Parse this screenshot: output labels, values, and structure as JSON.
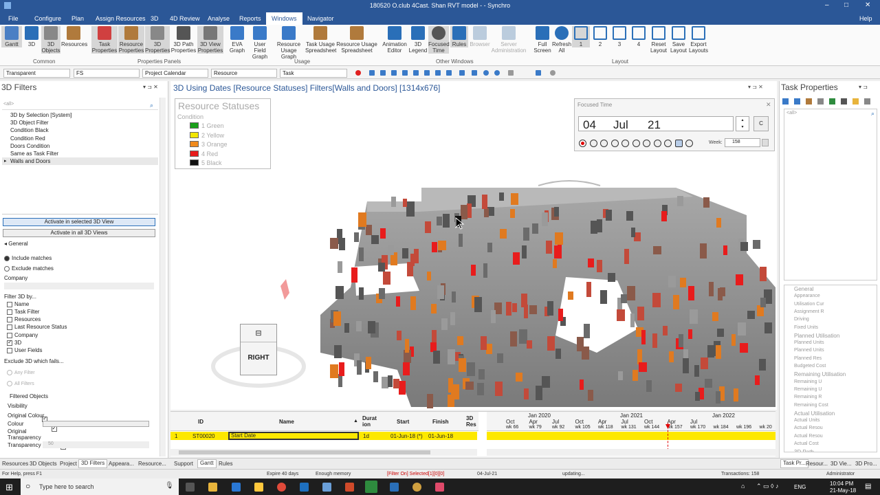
{
  "app": {
    "title": "180520 O.club 4Cast. Shan RVT model - - Synchro"
  },
  "menu": {
    "file": "File",
    "configure": "Configure",
    "plan": "Plan",
    "assign": "Assign Resources",
    "three_d": "3D",
    "review": "4D Review",
    "analyse": "Analyse",
    "reports": "Reports",
    "windows": "Windows",
    "navigator": "Navigator",
    "help": "Help"
  },
  "ribbon": {
    "buttons": [
      "Gantt",
      "3D",
      "3D Objects",
      "Resources",
      "Task Properties",
      "Resource Properties",
      "3D Properties",
      "3D Path Properties",
      "3D View Properties",
      "EVA Graph",
      "User Field Graph",
      "Resource Usage Graph",
      "Task Usage Spreadsheet",
      "Resource Usage Spreadsheet",
      "Animation Editor",
      "3D Legend",
      "Focused Time",
      "Rules",
      "Browser",
      "Server Administration",
      "Full Screen",
      "Refresh All",
      "1",
      "2",
      "3",
      "4",
      "Reset Layout",
      "Save Layout",
      "Export Layouts"
    ],
    "groups": {
      "common": "Common",
      "properties": "Properties Panels",
      "usage": "Usage",
      "other": "Other Windows",
      "layout": "Layout"
    }
  },
  "toolbar": {
    "transparent": "Transparent",
    "fs": "FS",
    "calendar": "Project Calendar",
    "resource": "Resource",
    "task": "Task"
  },
  "filters": {
    "header": "3D Filters",
    "search": "<all>",
    "items": [
      "3D by Selection [System]",
      "3D Object Filter",
      "Condition Black",
      "Condition Red",
      "Doors Condition",
      "Same as Task Filter",
      "Walls and Doors"
    ],
    "activate_selected": "Activate in selected 3D View",
    "activate_all": "Activate in all 3D Views",
    "general": "General",
    "include": "Include matches",
    "exclude": "Exclude matches",
    "company": "Company",
    "filter_by": "Filter 3D by...",
    "filter_opts": [
      "Name",
      "Task Filter",
      "Resources",
      "Last Resource Status",
      "Company",
      "3D",
      "User Fields"
    ],
    "exclude_fails": "Exclude 3D which fails...",
    "any_filter": "Any Filter",
    "all_filters": "All Filters",
    "filtered_objects": "Filtered Objects",
    "visibility": "Visibility",
    "orig_colour": "Original Colour",
    "colour": "Colour",
    "orig_transp": "Original Transparency",
    "transparency": "Transparency",
    "transp_val": "50"
  },
  "view": {
    "title": "3D Using Dates [Resource Statuses] Filters[Walls and Doors] [1314x676]",
    "cube_label": "RIGHT"
  },
  "legend": {
    "title": "Resource Statuses",
    "sub": "Condition",
    "items": [
      {
        "label": "1 Green",
        "color": "#1aa01a"
      },
      {
        "label": "2 Yellow",
        "color": "#f2e600"
      },
      {
        "label": "3 Orange",
        "color": "#f08a1c"
      },
      {
        "label": "4 Red",
        "color": "#e81c1c"
      },
      {
        "label": "5 Black",
        "color": "#111111"
      }
    ]
  },
  "focused_time": {
    "title": "Focused Time",
    "day": "04",
    "month": "Jul",
    "year": "21",
    "c": "C",
    "week_label": "Week:",
    "week": "158"
  },
  "gantt": {
    "cols": [
      "ID",
      "Name",
      "Durat ion",
      "Start",
      "Finish",
      "3D Res"
    ],
    "row": {
      "num": "1",
      "id": "ST00020",
      "name": "Start Date",
      "dur": "1d",
      "start": "01-Jun-18 (*)",
      "finish": "01-Jun-18"
    },
    "years": [
      "Jan 2020",
      "Jan 2021",
      "Jan 2022"
    ],
    "months": [
      "Oct",
      "Apr",
      "Jul",
      "Oct",
      "Apr",
      "Jul",
      "Oct",
      "Apr",
      "Jul"
    ],
    "weeks": [
      "wk 66",
      "wk 79",
      "wk 92",
      "wk 105",
      "wk 118",
      "wk 131",
      "wk 144",
      "wk 157",
      "wk 170",
      "wk 184",
      "wk 196",
      "wk 20"
    ]
  },
  "task_props": {
    "header": "Task Properties",
    "search": "<all>",
    "rows": [
      {
        "h": true,
        "t": "General"
      },
      {
        "t": "Appearance"
      },
      {
        "t": "Utilisation Cur"
      },
      {
        "t": "Assignment R"
      },
      {
        "t": "Driving"
      },
      {
        "t": "Fixed Units"
      },
      {
        "h": true,
        "t": "Planned Utilisation"
      },
      {
        "t": "Planned Units"
      },
      {
        "t": "Planned Units"
      },
      {
        "t": "Planned Res"
      },
      {
        "t": "Budgeted Cost"
      },
      {
        "h": true,
        "t": "Remaining Utilisation"
      },
      {
        "t": "Remaining U"
      },
      {
        "t": "Remaining U"
      },
      {
        "t": "Remaining R"
      },
      {
        "t": "Remaining Cost"
      },
      {
        "h": true,
        "t": "Actual Utilisation"
      },
      {
        "t": "Actual Units"
      },
      {
        "t": "Actual Resou"
      },
      {
        "t": "Actual Resou"
      },
      {
        "t": "Actual Cost"
      },
      {
        "h": true,
        "t": "3D Path"
      },
      {
        "t": "3D Path"
      }
    ]
  },
  "bottom_tabs": {
    "left": [
      "Resources",
      "3D Objects",
      "Project",
      "3D Filters",
      "Appeara...",
      "Resource..."
    ],
    "center": [
      "Support",
      "Gantt",
      "Rules"
    ],
    "right": [
      "Task Pr...",
      "Resour...",
      "3D Vie...",
      "3D Pro..."
    ]
  },
  "status": {
    "help": "For Help, press F1",
    "expire": "Expire 40 days",
    "memory": "Enough memory",
    "filter": "[Filter On]  Selected[1][0][0]",
    "date": "04-Jul-21",
    "updating": "updating...",
    "transactions": "Transactions: 158",
    "user": "Administrator"
  },
  "taskbar": {
    "search": "Type here to search",
    "lang": "ENG",
    "time": "10:04 PM",
    "date": "21-May-18"
  }
}
